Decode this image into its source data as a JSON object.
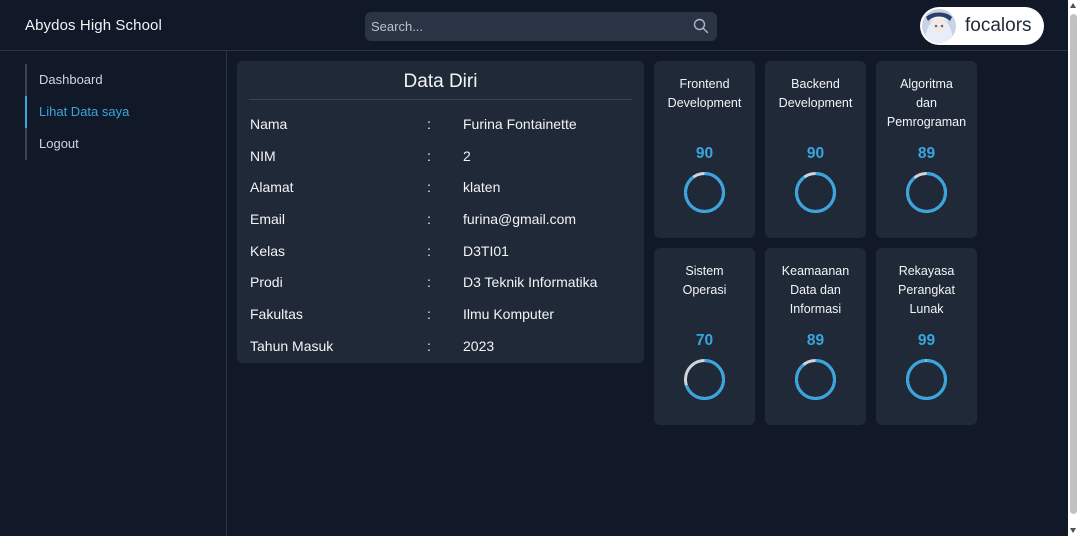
{
  "header": {
    "brand": "Abydos High School",
    "search_placeholder": "Search...",
    "username": "focalors"
  },
  "sidebar": {
    "items": [
      {
        "label": "Dashboard",
        "active": false
      },
      {
        "label": "Lihat Data saya",
        "active": true
      },
      {
        "label": "Logout",
        "active": false
      }
    ]
  },
  "profile": {
    "title": "Data Diri",
    "separator": ":",
    "rows": [
      {
        "label": "Nama",
        "value": "Furina Fontainette"
      },
      {
        "label": "NIM",
        "value": "2"
      },
      {
        "label": "Alamat",
        "value": "klaten"
      },
      {
        "label": "Email",
        "value": "furina@gmail.com"
      },
      {
        "label": "Kelas",
        "value": "D3TI01"
      },
      {
        "label": "Prodi",
        "value": "D3 Teknik Informatika"
      },
      {
        "label": "Fakultas",
        "value": "Ilmu Komputer"
      },
      {
        "label": "Tahun Masuk",
        "value": "2023"
      }
    ]
  },
  "scores": [
    {
      "line1": "Frontend",
      "line2": "Development",
      "line3": "",
      "value": "90",
      "percent": 90
    },
    {
      "line1": "Backend",
      "line2": "Development",
      "line3": "",
      "value": "90",
      "percent": 90
    },
    {
      "line1": "Algoritma",
      "line2": "dan",
      "line3": "Pemrograman",
      "value": "89",
      "percent": 89
    },
    {
      "line1": "Sistem",
      "line2": "Operasi",
      "line3": "",
      "value": "70",
      "percent": 70
    },
    {
      "line1": "Keamaanan",
      "line2": "Data dan",
      "line3": "Informasi",
      "value": "89",
      "percent": 89
    },
    {
      "line1": "Rekayasa",
      "line2": "Perangkat",
      "line3": "Lunak",
      "value": "99",
      "percent": 99
    }
  ],
  "colors": {
    "background": "#111827",
    "card": "#1f2937",
    "accent": "#38a5e0",
    "ring_track": "#d1d5db"
  }
}
